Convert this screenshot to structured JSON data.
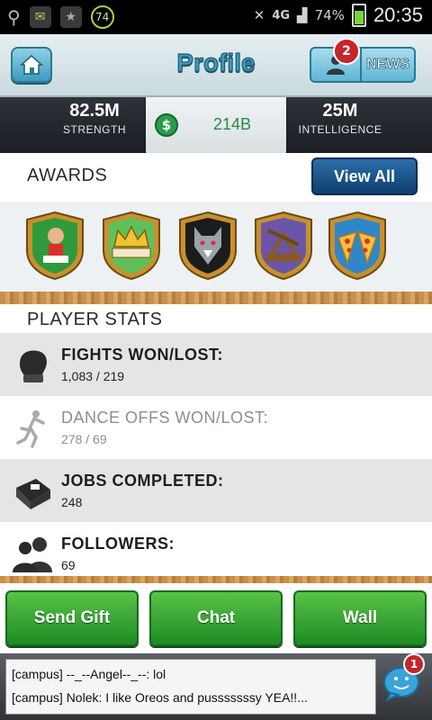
{
  "status_bar": {
    "notification_count": "74",
    "network": "4G",
    "battery": "74%",
    "time": "20:35"
  },
  "header": {
    "title": "Profile",
    "news_label": "NEWS",
    "news_badge": "2"
  },
  "stats": {
    "strength": {
      "value": "82.5M",
      "label": "STRENGTH"
    },
    "cash": {
      "value": "214B"
    },
    "intelligence": {
      "value": "25M",
      "label": "INTELLIGENCE"
    }
  },
  "awards": {
    "title": "AWARDS",
    "view_all": "View All",
    "badges": [
      "runner-award-icon",
      "crown-award-icon",
      "wolf-award-icon",
      "trebuchet-award-icon",
      "pizza-award-icon"
    ]
  },
  "player_stats": {
    "title": "PLAYER STATS",
    "rows": [
      {
        "label": "FIGHTS WON/LOST:",
        "value": "1,083 / 219",
        "icon": "boxing-glove-icon"
      },
      {
        "label": "DANCE OFFS WON/LOST:",
        "value": "278 / 69",
        "icon": "dancer-icon"
      },
      {
        "label": "JOBS COMPLETED:",
        "value": "248",
        "icon": "briefcase-icon"
      },
      {
        "label": "FOLLOWERS:",
        "value": "69",
        "icon": "followers-icon"
      }
    ]
  },
  "buttons": {
    "send_gift": "Send Gift",
    "chat": "Chat",
    "wall": "Wall"
  },
  "chat": {
    "lines": [
      "[campus] --_--Angel--_--: lol",
      "[campus] Nolek: I like Oreos and pusssssssy YEA!!..."
    ],
    "badge": "1"
  },
  "colors": {
    "accent_blue": "#3c9cbf",
    "view_all_blue": "#0f3f6f",
    "green_button": "#1f8a26",
    "badge_red": "#c4262a"
  }
}
